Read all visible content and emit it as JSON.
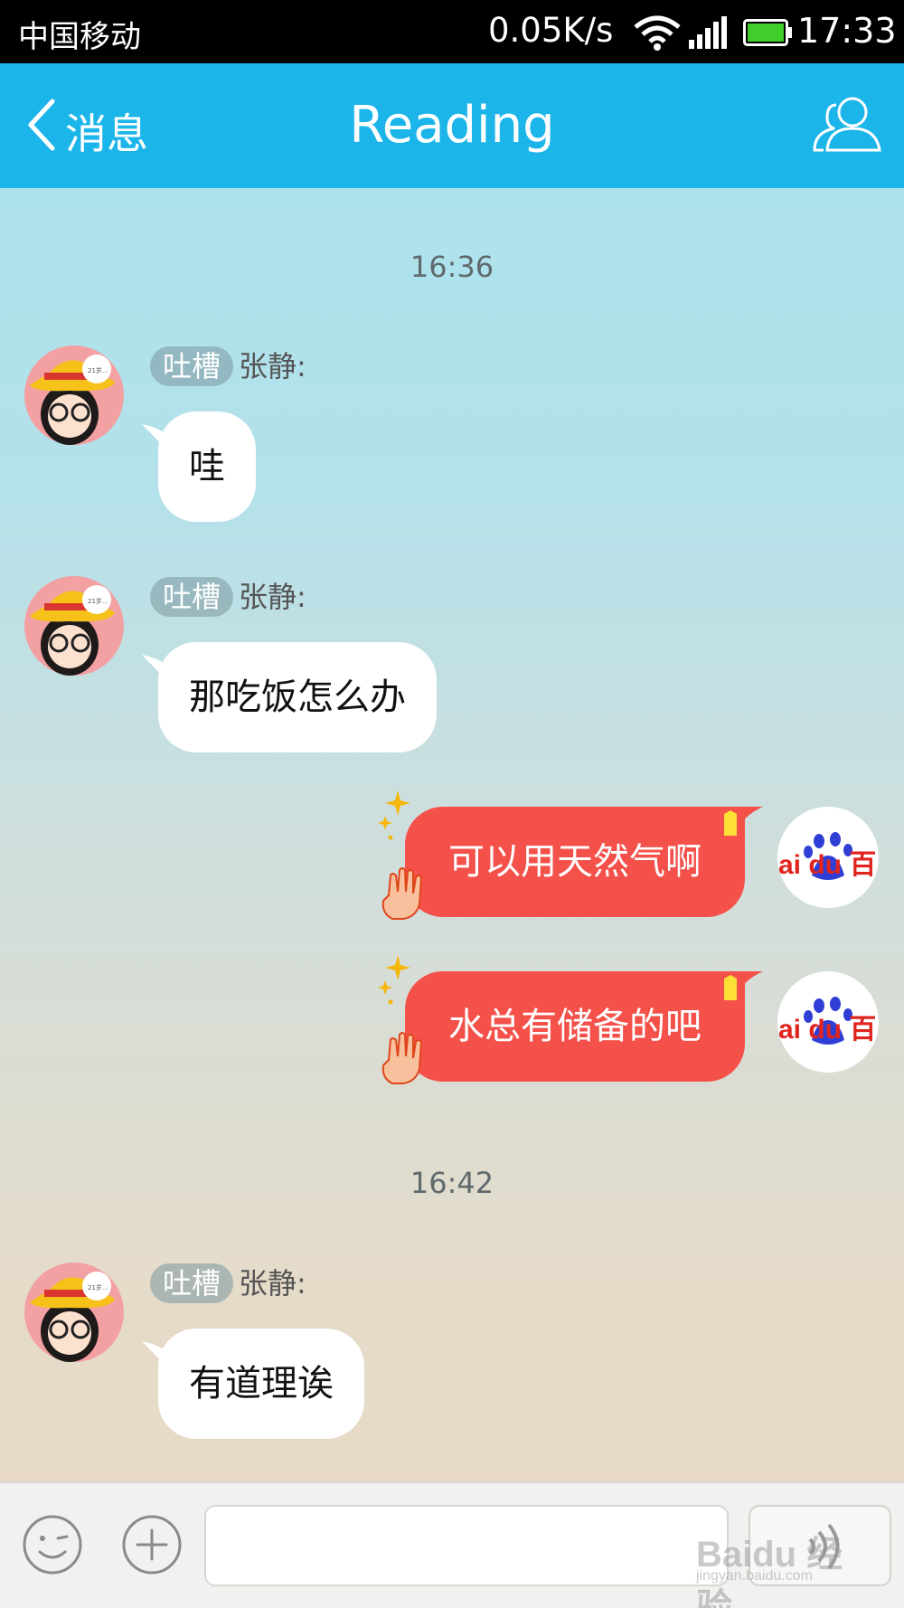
{
  "status_bar": {
    "carrier": "中国移动",
    "network_speed": "0.05K/s",
    "time": "17:33"
  },
  "header": {
    "back_label": "消息",
    "title": "Reading"
  },
  "timestamps": [
    "16:36",
    "16:42"
  ],
  "messages": [
    {
      "direction": "incoming",
      "tag": "吐槽",
      "sender": "张静:",
      "text": "哇"
    },
    {
      "direction": "incoming",
      "tag": "吐槽",
      "sender": "张静:",
      "text": "那吃饭怎么办"
    },
    {
      "direction": "outgoing",
      "text": "可以用天然气啊"
    },
    {
      "direction": "outgoing",
      "text": "水总有储备的吧"
    },
    {
      "direction": "incoming",
      "tag": "吐槽",
      "sender": "张静:",
      "text": "有道理诶"
    }
  ],
  "avatars": {
    "incoming_badge_text": "21岁...",
    "outgoing_logo_text": "ai du 百"
  },
  "watermark": {
    "brand": "Baidu 经验",
    "url": "jingyan.baidu.com"
  },
  "colors": {
    "header": "#1cb5ea",
    "outgoing_bubble": "#f4514a",
    "incoming_bubble": "#ffffff"
  }
}
